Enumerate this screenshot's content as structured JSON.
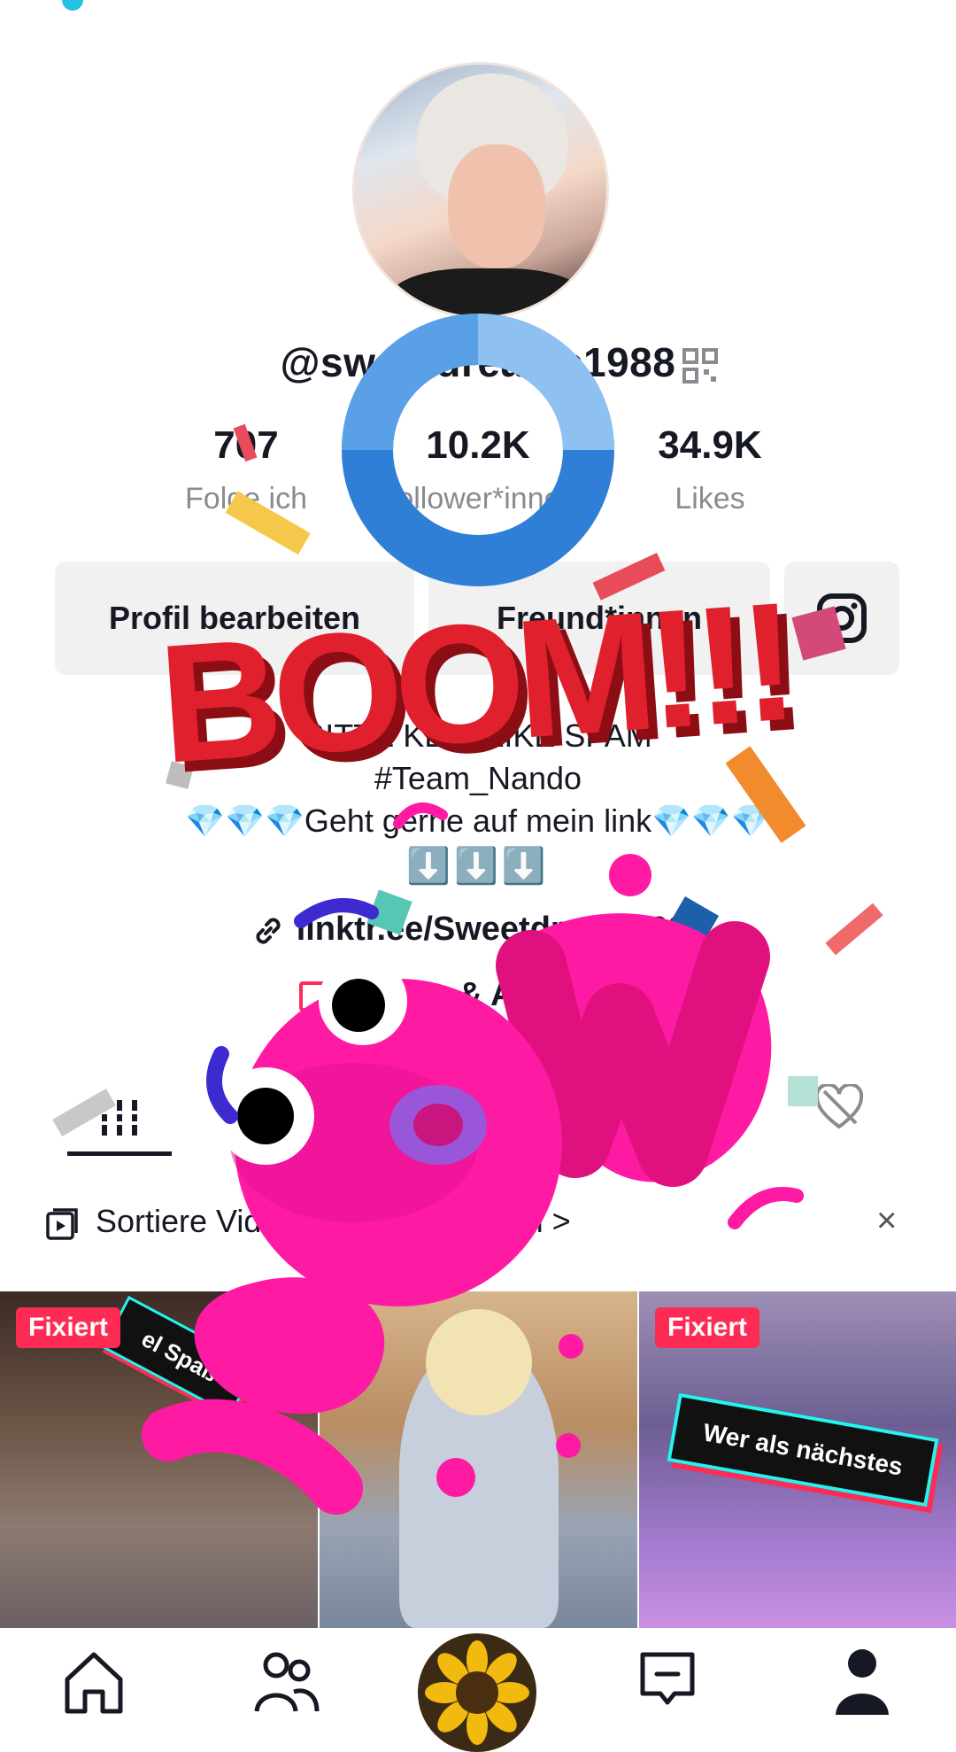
{
  "profile": {
    "username": "@sweetdreams1988",
    "stats": {
      "following_value": "707",
      "following_label": "Folge ich",
      "followers_value": "10.2K",
      "followers_label": "Follower*innen",
      "likes_value": "34.9K",
      "likes_label": "Likes"
    },
    "buttons": {
      "edit_label": "Profil bearbeiten",
      "friends_label": "Freund*innen"
    },
    "bio_lines": [
      "BITTE KEIN LIKE SPAM",
      "#Team_Nando",
      "💎💎💎Geht gerne auf mein link💎💎💎",
      "⬇️⬇️⬇️"
    ],
    "link": "linktr.ee/Sweetdreams083",
    "qa_label": "Fragen & Antworten"
  },
  "banner": {
    "text": "Sortiere Videos in Playlisten ein >",
    "close": "×"
  },
  "videos": [
    {
      "pin_label": "Fixiert",
      "sticker": "el Spaß"
    },
    {
      "pin_label": ""
    },
    {
      "pin_label": "Fixiert",
      "caption": "Wer als nächstes"
    }
  ],
  "overlay": {
    "boom_text": "BOOM!!!",
    "accent_pink": "#ff1aa3",
    "accent_red": "#e0212d",
    "donut_blue": "#4a90e2"
  },
  "icons": [
    "qr-icon",
    "instagram-icon",
    "link-icon",
    "grid-icon",
    "liked-hidden-icon",
    "playlist-icon",
    "close-icon",
    "home-icon",
    "friends-icon",
    "inbox-icon",
    "profile-icon"
  ]
}
